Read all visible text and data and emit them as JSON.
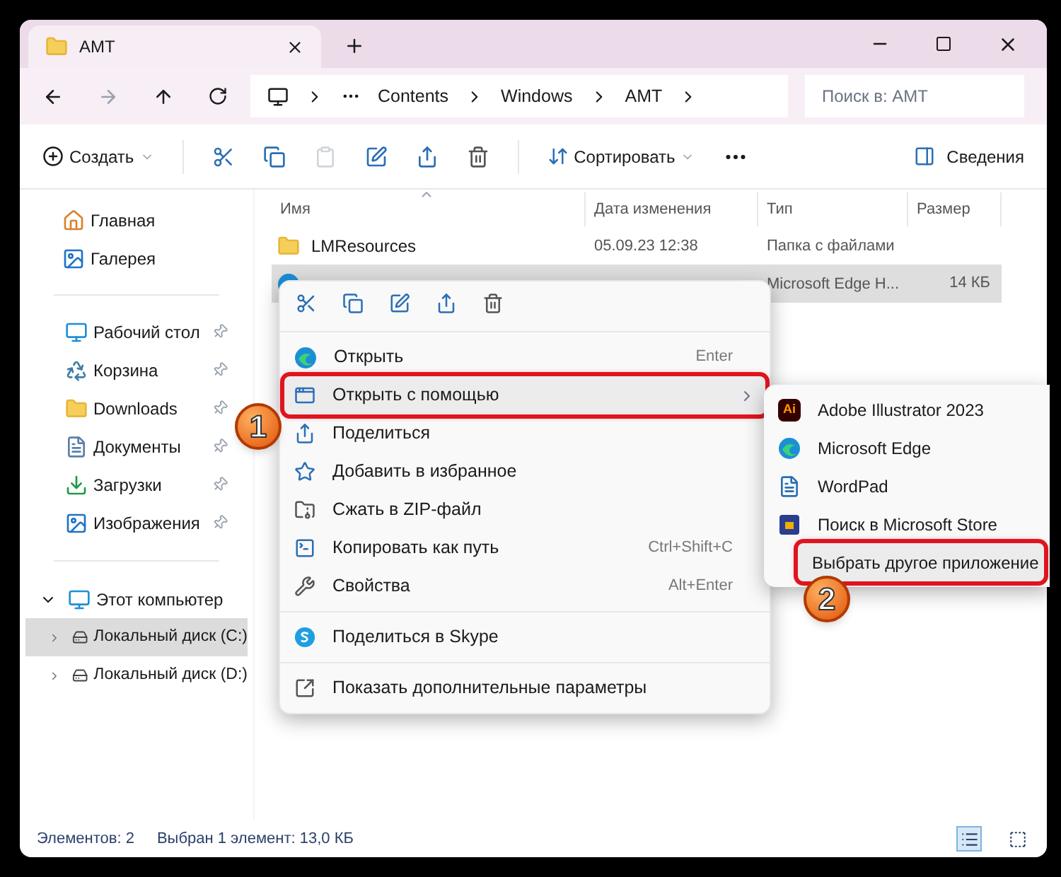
{
  "window": {
    "tab_title": "AMT",
    "breadcrumbs": [
      "Contents",
      "Windows",
      "AMT"
    ],
    "search": {
      "placeholder": "Поиск в: AMT"
    }
  },
  "toolbar": {
    "create": "Создать",
    "sort": "Сортировать",
    "details": "Сведения"
  },
  "sidebar": {
    "top": [
      {
        "label": "Главная",
        "selected": false
      },
      {
        "label": "Галерея",
        "selected": false
      }
    ],
    "quick_access": [
      {
        "label": "Рабочий стол",
        "pinned": true
      },
      {
        "label": "Корзина",
        "pinned": true
      },
      {
        "label": "Downloads",
        "pinned": true
      },
      {
        "label": "Документы",
        "pinned": true
      },
      {
        "label": "Загрузки",
        "pinned": true
      },
      {
        "label": "Изображения",
        "pinned": true
      }
    ],
    "tree": [
      {
        "label": "Этот компьютер",
        "expanded": true,
        "selected": false,
        "children": [
          {
            "label": "Локальный диск (C:)",
            "expanded": false,
            "selected": true
          },
          {
            "label": "Локальный диск (D:)",
            "expanded": false,
            "selected": false
          }
        ]
      }
    ]
  },
  "table": {
    "columns": [
      "Имя",
      "Дата изменения",
      "Тип",
      "Размер"
    ],
    "rows": [
      {
        "kind": "folder",
        "name": "LMResources",
        "date": "05.09.23 12:38",
        "type": "Папка с файлами",
        "selected": false
      },
      {
        "kind": "file",
        "type": "Microsoft Edge H...",
        "size": "14 КБ",
        "selected": true
      }
    ]
  },
  "context_menu": {
    "groups": [
      [
        {
          "label": "Открыть",
          "shortcut": "Enter",
          "submenu": false,
          "highlighted": false
        },
        {
          "label": "Открыть с помощью",
          "submenu": true,
          "highlighted": true,
          "callout": "1"
        },
        {
          "label": "Поделиться",
          "submenu": false,
          "highlighted": false
        },
        {
          "label": "Добавить в избранное",
          "submenu": false,
          "highlighted": false
        },
        {
          "label": "Сжать в ZIP-файл",
          "submenu": false,
          "highlighted": false
        },
        {
          "label": "Копировать как путь",
          "shortcut": "Ctrl+Shift+C",
          "submenu": false,
          "highlighted": false
        },
        {
          "label": "Свойства",
          "shortcut": "Alt+Enter",
          "submenu": false,
          "highlighted": false
        }
      ],
      [
        {
          "label": "Поделиться в Skype",
          "submenu": false,
          "highlighted": false
        }
      ],
      [
        {
          "label": "Показать дополнительные параметры",
          "submenu": false,
          "highlighted": false
        }
      ]
    ]
  },
  "submenu": {
    "items": [
      {
        "label": "Adobe Illustrator 2023",
        "icon_text": "Ai",
        "highlighted": false
      },
      {
        "label": "Microsoft Edge",
        "highlighted": false
      },
      {
        "label": "WordPad",
        "highlighted": false
      },
      {
        "label": "Поиск в Microsoft Store",
        "highlighted": false
      },
      {
        "label": "Выбрать другое приложение",
        "highlighted": true,
        "callout": "2"
      }
    ]
  },
  "status_bar": {
    "count": "Элементов: 2",
    "selection": "Выбран 1 элемент: 13,0 КБ",
    "views": [
      {
        "kind": "details",
        "selected": true
      },
      {
        "kind": "tiles",
        "selected": false
      }
    ]
  }
}
